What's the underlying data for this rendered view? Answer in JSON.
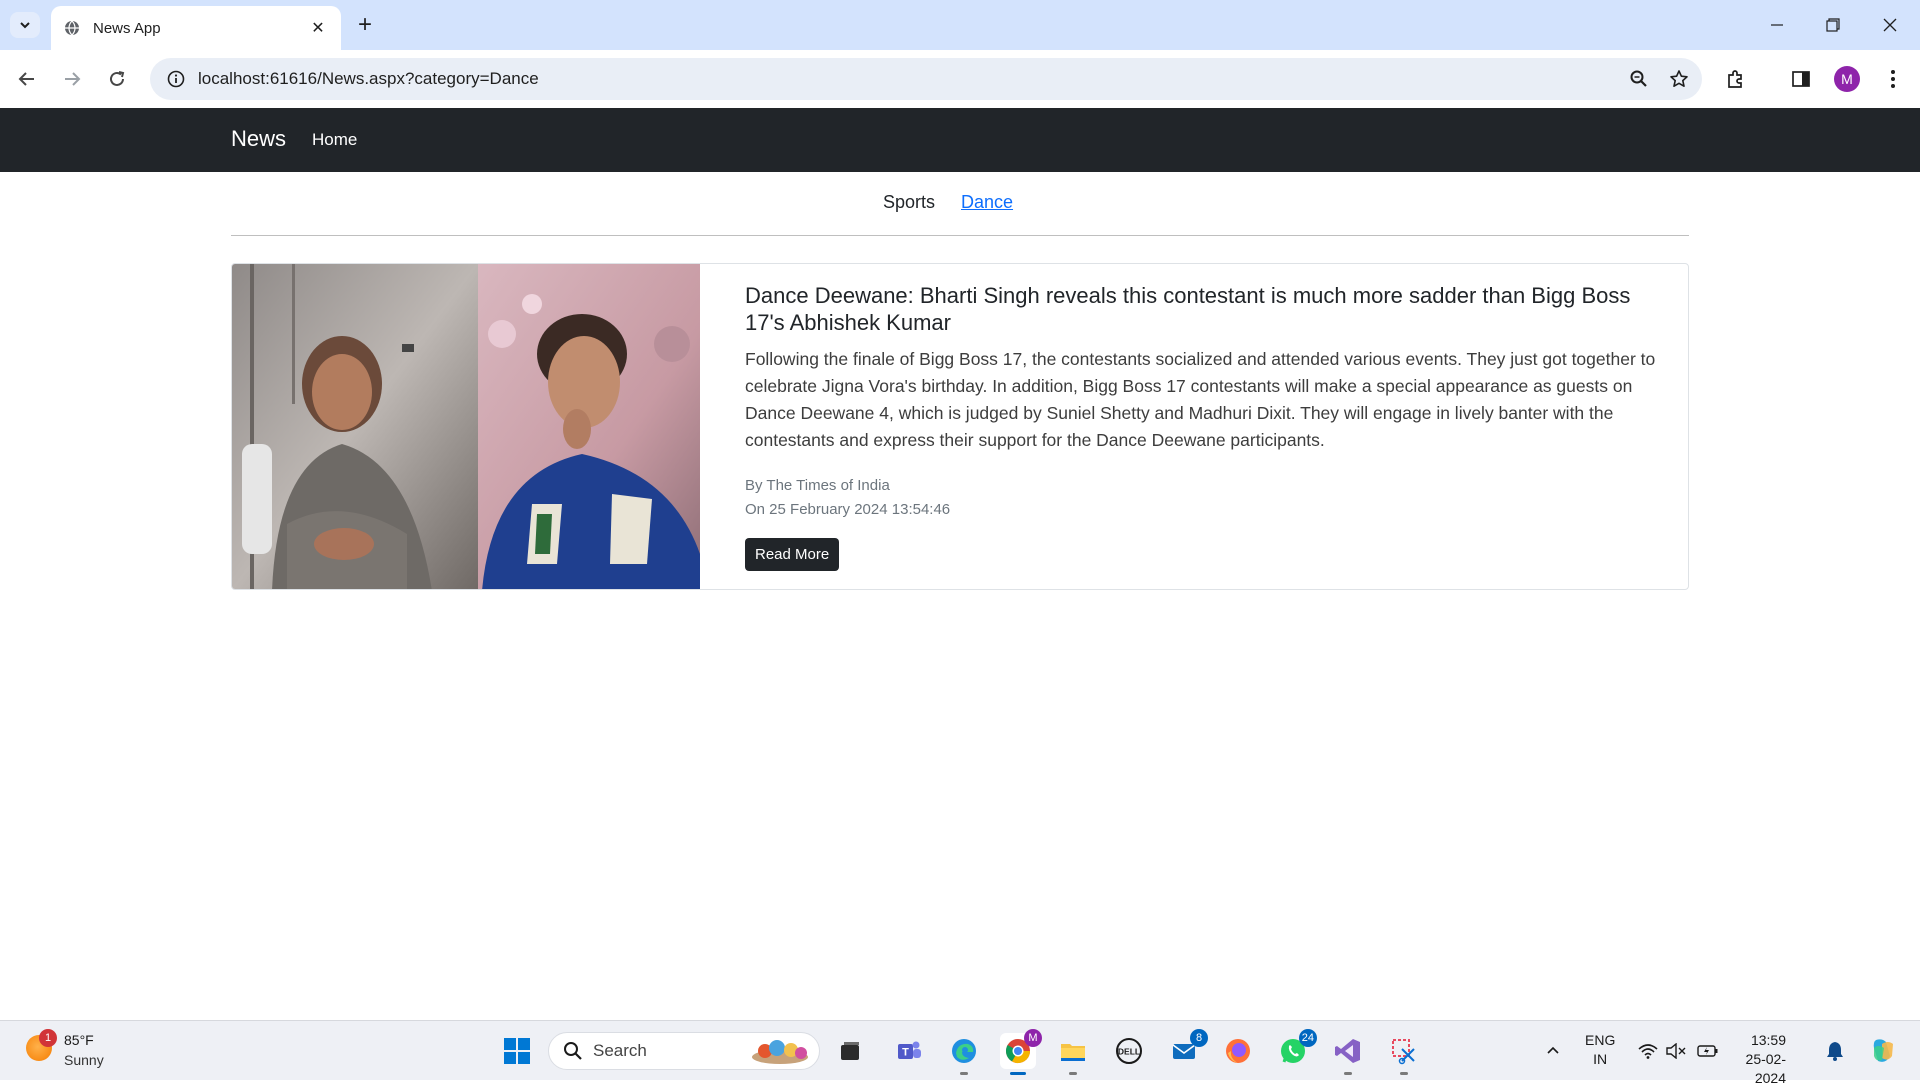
{
  "browser": {
    "tab_title": "News App",
    "url": "localhost:61616/News.aspx?category=Dance",
    "profile_initial": "M"
  },
  "site": {
    "brand": "News",
    "nav_home": "Home",
    "categories": [
      "Sports",
      "Dance"
    ],
    "active_category": "Dance"
  },
  "article": {
    "title": "Dance Deewane: Bharti Singh reveals this contestant is much more sadder than Bigg Boss 17's Abhishek Kumar",
    "description": "Following the finale of Bigg Boss 17, the contestants socialized and attended various events. They just got together to celebrate Jigna Vora's birthday. In addition, Bigg Boss 17 contestants will make a special appearance as guests on Dance Deewane 4, which is judged by Suniel Shetty and Madhuri Dixit. They will engage in lively banter with the contestants and express their support for the Dance Deewane participants.",
    "source": "By The Times of India",
    "date": "On 25 February 2024 13:54:46",
    "button": "Read More"
  },
  "taskbar": {
    "weather_temp": "85°F",
    "weather_cond": "Sunny",
    "weather_badge": "1",
    "search_label": "Search",
    "chrome_badge": "M",
    "mail_badge": "8",
    "whatsapp_badge": "24",
    "lang_line1": "ENG",
    "lang_line2": "IN",
    "time": "13:59",
    "date": "25-02-2024"
  },
  "colors": {
    "navbar": "#212529",
    "link": "#0d6efd",
    "tab_strip": "#d3e3fd"
  }
}
